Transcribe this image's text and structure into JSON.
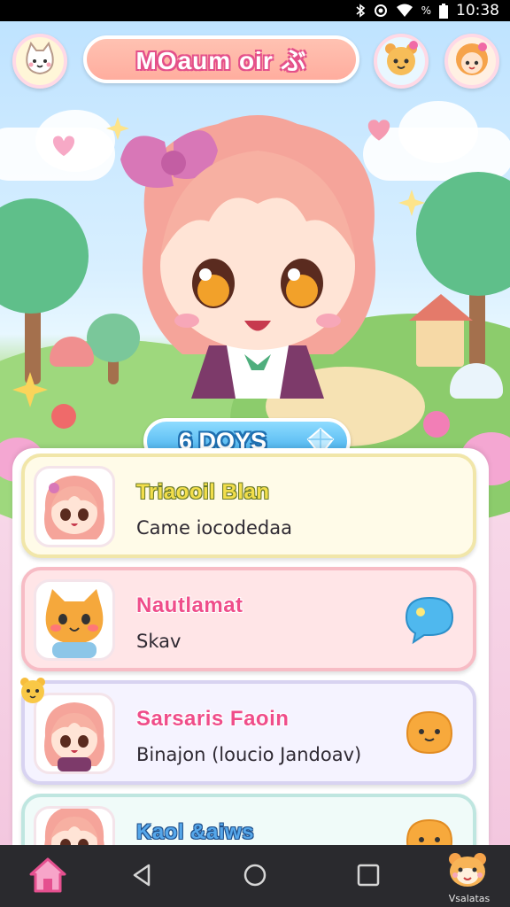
{
  "status_bar": {
    "time": "10:38",
    "battery_text": "%",
    "icons": [
      "bluetooth-icon",
      "alarm-icon",
      "wifi-icon",
      "battery-icon"
    ]
  },
  "header": {
    "title": "MOaum oir ぶ",
    "left_avatar_icon": "cat-face-icon",
    "right_avatars": [
      "bear-girl-avatar",
      "bear-girl-orange-avatar"
    ]
  },
  "badge": {
    "label": "6  DOYS",
    "icon": "blue-gem-icon"
  },
  "list": {
    "items": [
      {
        "name": "Triaooil Blan",
        "subtitle": "Came iocodedaa",
        "avatar": "pink-hair-girl-avatar",
        "action_icon": "",
        "name_color": "#e8d84a",
        "border_color": "#f1e6a9",
        "bg_color": "#fffbe8"
      },
      {
        "name": "Nautlamat",
        "subtitle": "Skav",
        "avatar": "orange-cat-avatar",
        "action_icon": "chat-bubble-icon",
        "name_color": "#e9467f",
        "border_color": "#f7bcc5",
        "bg_color": "#ffe5e7"
      },
      {
        "name": "Sarsaris Faoin",
        "subtitle": "Binajon (loucio Jandoav)",
        "avatar": "pink-hair-girl-avatar",
        "action_icon": "orange-blob-icon",
        "name_color": "#e9467f",
        "border_color": "#d8d3f1",
        "bg_color": "#f5f3ff"
      },
      {
        "name": "Kaol &aiws",
        "subtitle": "",
        "avatar": "pink-hair-girl-avatar",
        "action_icon": "orange-blob-icon",
        "name_color": "#3d8fd9",
        "border_color": "#bfe6e0",
        "bg_color": "#f0fbf9"
      }
    ]
  },
  "navbar": {
    "items": [
      "home-icon",
      "back-icon",
      "home-circle-icon",
      "recents-icon",
      "bear-icon"
    ],
    "bear_label": "Vsalatas"
  },
  "colors": {
    "accent_pink": "#e4508a",
    "accent_blue": "#39a8ea",
    "navbar": "#2a2a2e"
  }
}
